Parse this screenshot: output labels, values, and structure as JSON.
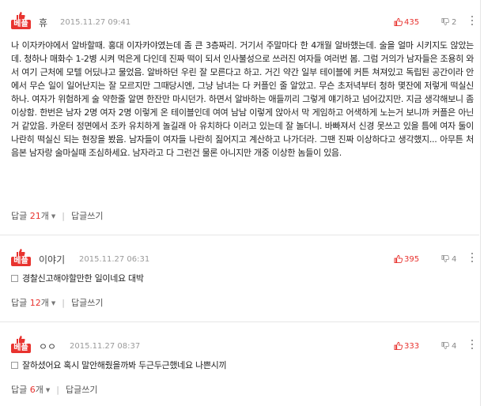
{
  "best_label": "베플",
  "reply_label": "답글",
  "count_suffix": "개",
  "write_reply_label": "답글쓰기",
  "accent": "#e8332f",
  "comments": [
    {
      "nickname": "휴",
      "date": "2015.11.27 09:41",
      "likes": "435",
      "dislikes": "2",
      "body": "나 이자카야에서 알바할때. 홍대 이자카야였는데 좀 큰 3층짜리. 거기서 주말마다 한 4개월 알바했는데. 술을 얼마 시키지도 않았는데. 청하나 매화수 1-2병 시켜 먹은게 다인데 진짜 떡이 되서 인사불성으로 쓰러진 여자들 여러번 봄. 그럼 거의가 남자들은 조용히 와서 여기 근처에 모텔 어딨냐고 물었음. 알바하던 우린 잘 모른다고 하고. 거긴 약간 일부 테이블에 커튼 쳐져있고 독립된 공간이라 안에서 무슨 일이 일어난지는 잘 모르지만 그때당시엔, 그냥 남녀는 다 커플인 줄 알았고. 무슨 초저녁부터 청하 몇잔에 저렇게 떡실신 하나. 여자가 위험하게 술 약한줄 알면 한잔만 마시던가. 하면서 알바하는 애들끼리 그렇게 얘기하고 넘어갔지만. 지금 생각해보니 좀 이상함. 한번은 남자 2명 여자 2명 이렇게 온 테이블인데 여여 남남 이렇게 앉아서 막 게임하고 어색하게 노는거 보니까 커플은 아닌거 같았음. 카운터 정면에서 조카 유치하게 놀길래 아 유치하다 이러고 있는데 잘 놀더니. 바빠져서 신경 못쓰고 있을 틈에 여자 둘이 나란히 떡실신 되는 현장을 봤음. 남자들이 여자들 나란히 짊어지고 계산하고 나가더라. 그땐 진짜 이상하다고 생각했지... 아무튼 처음본 남자랑 술마실때 조심하세요. 남자라고 다 그런건 물론 아니지만 개중 이상한 놈들이 있음.",
      "reply_count": "21"
    },
    {
      "nickname": "이야기",
      "date": "2015.11.27 06:31",
      "likes": "395",
      "dislikes": "4",
      "body": "경찰신고해야할만한 일이네요 대박",
      "reply_count": "12"
    },
    {
      "nickname": "ㅇㅇ",
      "date": "2015.11.27 08:37",
      "likes": "333",
      "dislikes": "4",
      "body": "잘하셨어요 혹시 말안해줬을까봐 두근두근했네요 나쁜시끼",
      "reply_count": "6"
    }
  ]
}
